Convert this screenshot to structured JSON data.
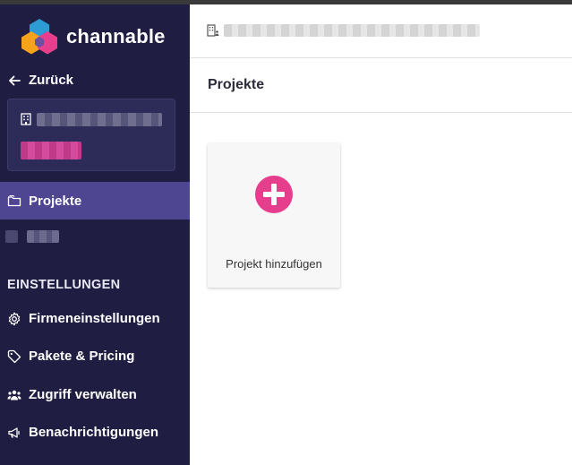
{
  "brand": {
    "name": "channable",
    "logo_colors": [
      "#f7a21b",
      "#e73f8e",
      "#2d9bd4",
      "#6b4fa3"
    ]
  },
  "sidebar": {
    "back_label": "Zurück",
    "nav_projects_label": "Projekte",
    "section_label": "EINSTELLUNGEN",
    "items": [
      {
        "label": "Firmeneinstellungen",
        "icon": "gear-icon"
      },
      {
        "label": "Pakete & Pricing",
        "icon": "tag-icon"
      },
      {
        "label": "Zugriff verwalten",
        "icon": "users-icon"
      },
      {
        "label": "Benachrichtigungen",
        "icon": "megaphone-icon"
      }
    ]
  },
  "main": {
    "page_title": "Projekte",
    "add_project_label": "Projekt hinzufügen"
  },
  "colors": {
    "sidebar_bg": "#1f1d42",
    "active_item_bg": "#4f4692",
    "accent_pink": "#e63d8d"
  }
}
